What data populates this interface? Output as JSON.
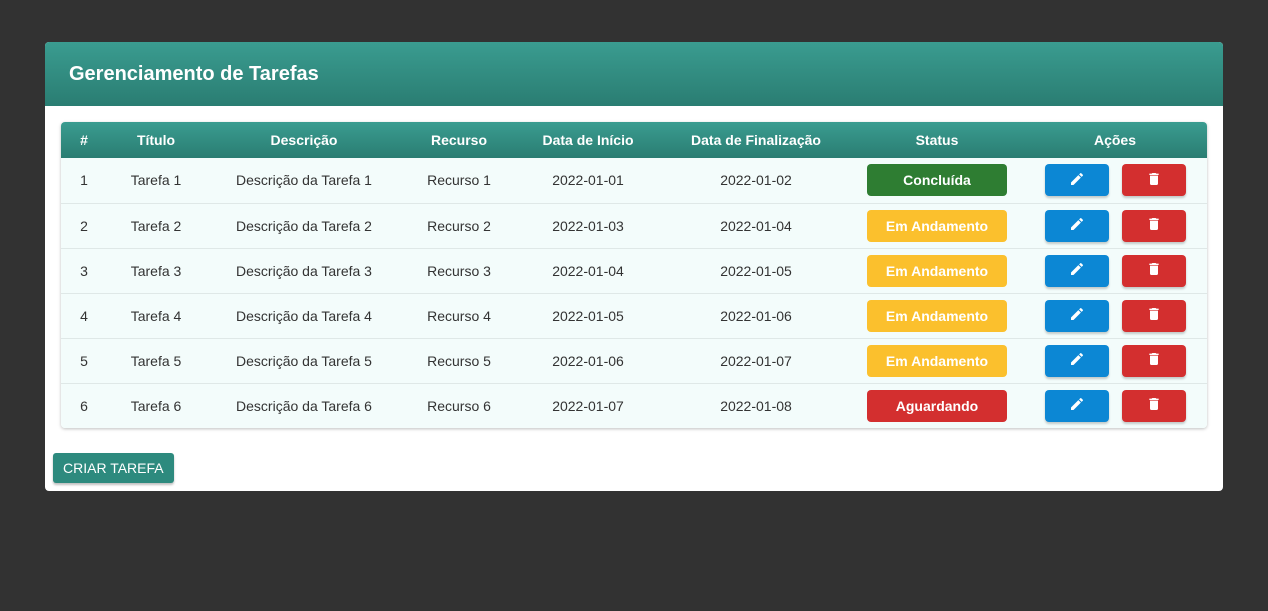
{
  "header": {
    "title": "Gerenciamento de Tarefas"
  },
  "table": {
    "columns": [
      "#",
      "Título",
      "Descrição",
      "Recurso",
      "Data de Início",
      "Data de Finalização",
      "Status",
      "Ações"
    ],
    "rows": [
      {
        "id": "1",
        "titulo": "Tarefa 1",
        "descricao": "Descrição da Tarefa 1",
        "recurso": "Recurso 1",
        "inicio": "2022-01-01",
        "fim": "2022-01-02",
        "status": "Concluída",
        "status_color": "#2e7d32"
      },
      {
        "id": "2",
        "titulo": "Tarefa 2",
        "descricao": "Descrição da Tarefa 2",
        "recurso": "Recurso 2",
        "inicio": "2022-01-03",
        "fim": "2022-01-04",
        "status": "Em Andamento",
        "status_color": "#fbc02d"
      },
      {
        "id": "3",
        "titulo": "Tarefa 3",
        "descricao": "Descrição da Tarefa 3",
        "recurso": "Recurso 3",
        "inicio": "2022-01-04",
        "fim": "2022-01-05",
        "status": "Em Andamento",
        "status_color": "#fbc02d"
      },
      {
        "id": "4",
        "titulo": "Tarefa 4",
        "descricao": "Descrição da Tarefa 4",
        "recurso": "Recurso 4",
        "inicio": "2022-01-05",
        "fim": "2022-01-06",
        "status": "Em Andamento",
        "status_color": "#fbc02d"
      },
      {
        "id": "5",
        "titulo": "Tarefa 5",
        "descricao": "Descrição da Tarefa 5",
        "recurso": "Recurso 5",
        "inicio": "2022-01-06",
        "fim": "2022-01-07",
        "status": "Em Andamento",
        "status_color": "#fbc02d"
      },
      {
        "id": "6",
        "titulo": "Tarefa 6",
        "descricao": "Descrição da Tarefa 6",
        "recurso": "Recurso 6",
        "inicio": "2022-01-07",
        "fim": "2022-01-08",
        "status": "Aguardando",
        "status_color": "#d32f2f"
      }
    ]
  },
  "icons": {
    "edit": "pencil-icon",
    "delete": "trash-icon"
  },
  "colors": {
    "header": "#2f8a7f",
    "edit_button": "#0c87d4",
    "delete_button": "#d32f2f",
    "concluida": "#2e7d32",
    "em_andamento": "#fbc02d",
    "aguardando": "#d32f2f"
  },
  "create_button": {
    "label": "CRIAR TAREFA"
  }
}
